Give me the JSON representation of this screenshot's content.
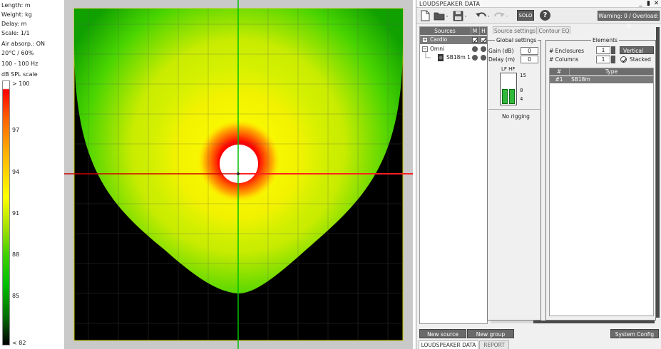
{
  "info": {
    "lines": [
      "Length: m",
      "Weight: kg",
      "Delay: m",
      "Scale: 1/1",
      "Air absorp.: ON",
      "20°C / 60%",
      "100 - 100 Hz",
      "dB SPL scale"
    ],
    "scale_ticks": [
      "> 100",
      "97",
      "94",
      "91",
      "88",
      "85",
      "< 82"
    ]
  },
  "panel": {
    "title": "LOUDSPEAKER DATA",
    "window_buttons": [
      "_",
      "▮",
      "✕"
    ],
    "toolbar": {
      "solo_label": "SOLO",
      "help_label": "?",
      "warning": "Warning: 0 / Overload: 0"
    },
    "sources": {
      "header": {
        "title": "Sources",
        "m": "M",
        "h": "H"
      },
      "items": [
        {
          "label": "Cardio"
        },
        {
          "label": "Omni"
        },
        {
          "label": "SB18m 1"
        }
      ],
      "expand_symbols": [
        "+",
        "−"
      ]
    },
    "tabs": [
      "Source settings",
      "Contour EQ"
    ],
    "global_settings": {
      "title": "Global settings",
      "gain_label": "Gain (dB)",
      "gain_value": "0",
      "delay_label": "Delay (m)",
      "delay_value": "0",
      "lfhf_label": "LF HF",
      "meter_ticks": [
        "15",
        "8",
        "4"
      ],
      "rigging": "No rigging"
    },
    "elements": {
      "title": "Elements",
      "enclosures_label": "# Enclosures",
      "enclosures_value": "1",
      "columns_label": "# Columns",
      "columns_value": "1",
      "orientation": "Vertical",
      "stacked_label": "Stacked",
      "table_headers": [
        "#",
        "Type"
      ],
      "rows": [
        {
          "num": "#1",
          "type": "SB18m"
        }
      ]
    },
    "bottom_buttons": {
      "new_source": "New source",
      "new_group": "New group",
      "system_config": "System Config"
    },
    "bottom_tabs": [
      "LOUDSPEAKER DATA",
      "REPORT"
    ]
  },
  "colors": {
    "accent_dark": "#6d6d6d",
    "spl_high": "#ff0000",
    "spl_mid": "#ffff00",
    "spl_low": "#00c000",
    "axis_green": "#00c000",
    "axis_red": "#d00000"
  }
}
